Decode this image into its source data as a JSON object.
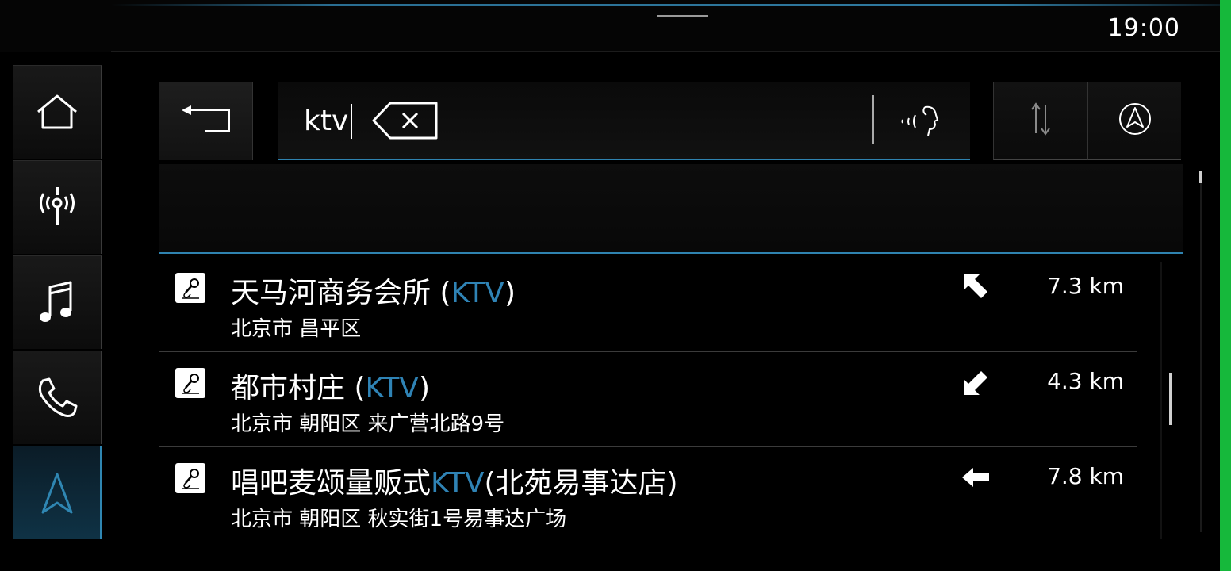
{
  "status_bar": {
    "time": "19:00"
  },
  "sidebar": {
    "items": [
      {
        "icon": "home-icon"
      },
      {
        "icon": "radio-antenna-icon"
      },
      {
        "icon": "music-note-icon"
      },
      {
        "icon": "phone-icon"
      },
      {
        "icon": "navigation-arrow-icon",
        "active": true
      }
    ]
  },
  "search": {
    "query": "ktv",
    "back_icon": "back-arrow-icon",
    "clear_icon": "backspace-clear-icon",
    "voice_icon": "voice-input-icon",
    "sort_icon": "sort-arrows-icon",
    "nav_icon": "compass-arrow-icon"
  },
  "results": [
    {
      "name_prefix": "天马河商务会所 (",
      "name_highlight": "KTV",
      "name_suffix": ")",
      "address": "北京市 昌平区",
      "direction": "up-left",
      "distance": "7.3 km"
    },
    {
      "name_prefix": "都市村庄 (",
      "name_highlight": "KTV",
      "name_suffix": ")",
      "address": "北京市 朝阳区 来广营北路9号",
      "direction": "down-left",
      "distance": "4.3 km"
    },
    {
      "name_prefix": "唱吧麦颂量贩式",
      "name_highlight": "KTV",
      "name_suffix": "(北苑易事达店)",
      "address": "北京市 朝阳区 秋实街1号易事达广场",
      "direction": "left",
      "distance": "7.8 km"
    }
  ],
  "colors": {
    "accent": "#2f83b5",
    "background": "#000000",
    "edge_green": "#16b83b"
  }
}
